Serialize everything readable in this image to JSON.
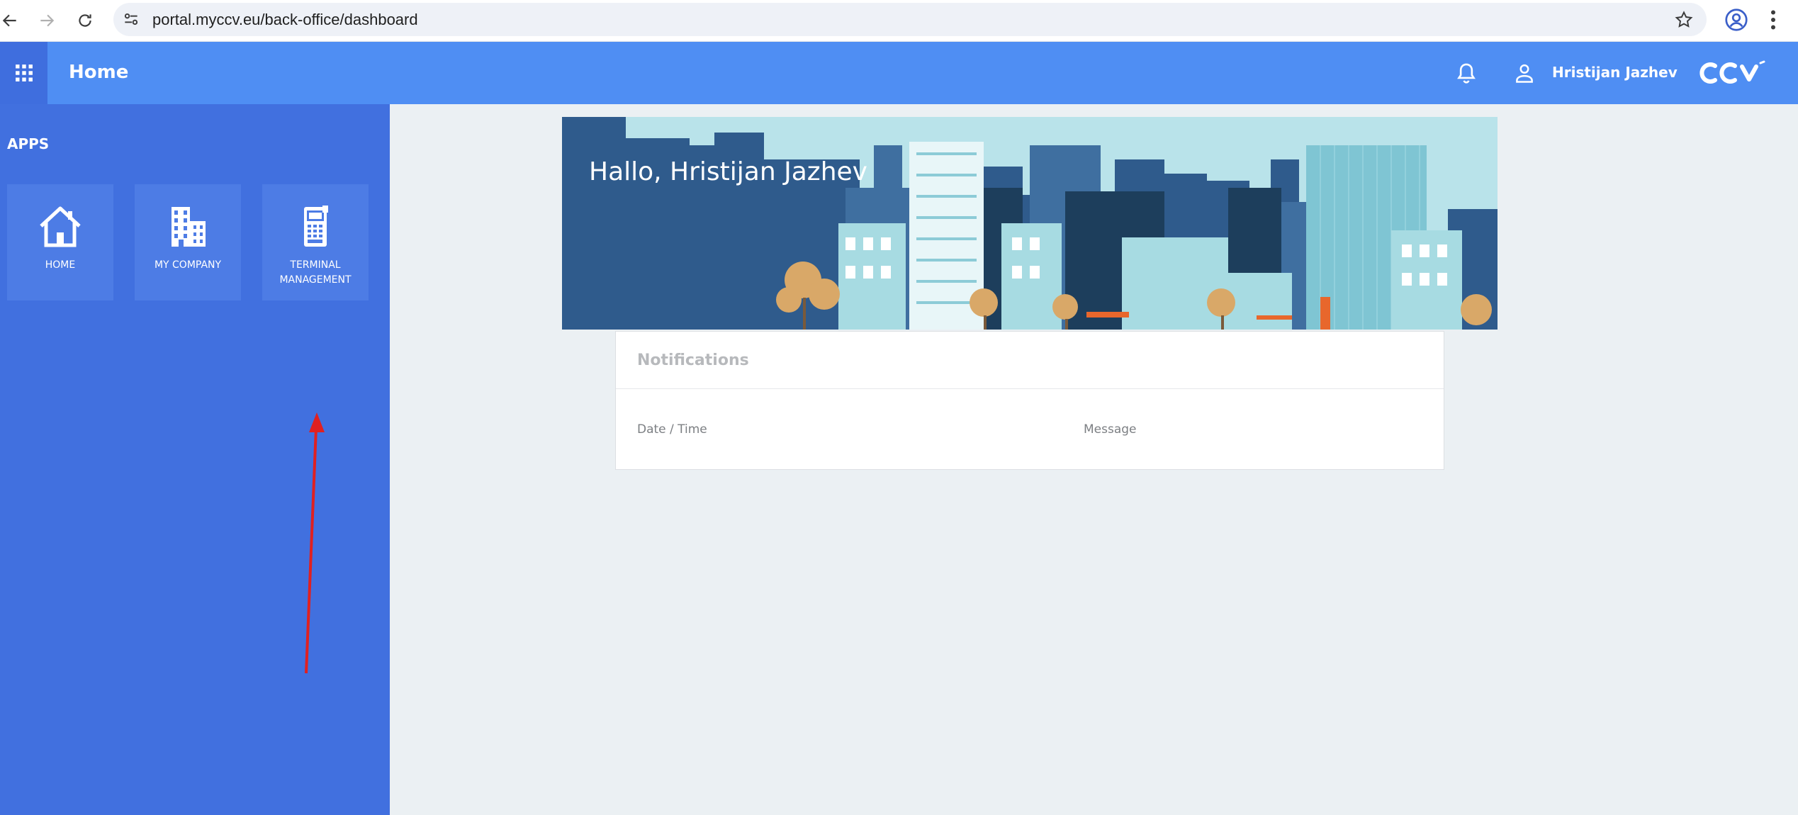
{
  "browser": {
    "url": "portal.myccv.eu/back-office/dashboard"
  },
  "header": {
    "title": "Home",
    "user_name": "Hristijan Jazhev",
    "brand": "CCV",
    "accent_color": "#4f8ef3"
  },
  "sidebar": {
    "heading": "APPS",
    "background_color": "#4170df",
    "tiles": [
      {
        "label": "HOME",
        "icon": "home-icon"
      },
      {
        "label": "MY COMPANY",
        "icon": "building-icon"
      },
      {
        "label": "TERMINAL MANAGEMENT",
        "icon": "payment-terminal-icon"
      }
    ]
  },
  "main": {
    "greeting": "Hallo, Hristijan Jazhev",
    "notifications": {
      "title": "Notifications",
      "columns": [
        "Date / Time",
        "Message"
      ]
    }
  },
  "annotation": {
    "type": "red-arrow",
    "color": "#e02020",
    "points_to": "TERMINAL MANAGEMENT"
  }
}
